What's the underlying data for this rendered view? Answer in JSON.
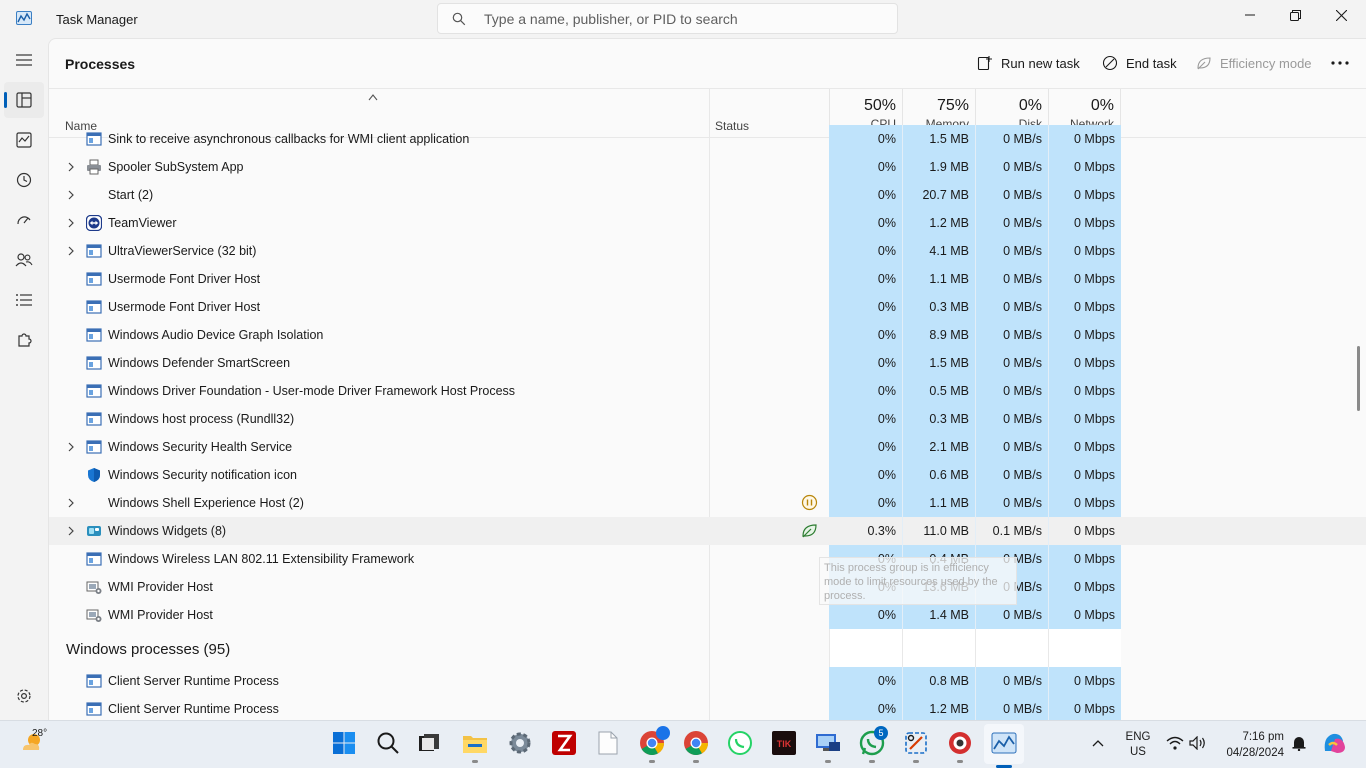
{
  "window": {
    "title": "Task Manager"
  },
  "search": {
    "placeholder": "Type a name, publisher, or PID to search"
  },
  "page": {
    "title": "Processes"
  },
  "toolbar": {
    "run_new_task": "Run new task",
    "end_task": "End task",
    "efficiency_mode": "Efficiency mode"
  },
  "columns": {
    "name": "Name",
    "status": "Status",
    "cpu": {
      "percent": "50%",
      "label": "CPU"
    },
    "memory": {
      "percent": "75%",
      "label": "Memory"
    },
    "disk": {
      "percent": "0%",
      "label": "Disk"
    },
    "network": {
      "percent": "0%",
      "label": "Network"
    }
  },
  "rows": [
    {
      "name": "Sink to receive asynchronous callbacks for WMI client application",
      "expandable": false,
      "icon": "window-icon",
      "cpu": "0%",
      "memory": "1.5 MB",
      "disk": "0 MB/s",
      "network": "0 Mbps"
    },
    {
      "name": "Spooler SubSystem App",
      "expandable": true,
      "icon": "printer-icon",
      "cpu": "0%",
      "memory": "1.9 MB",
      "disk": "0 MB/s",
      "network": "0 Mbps"
    },
    {
      "name": "Start (2)",
      "expandable": true,
      "icon": "",
      "cpu": "0%",
      "memory": "20.7 MB",
      "disk": "0 MB/s",
      "network": "0 Mbps"
    },
    {
      "name": "TeamViewer",
      "expandable": true,
      "icon": "teamviewer-icon",
      "cpu": "0%",
      "memory": "1.2 MB",
      "disk": "0 MB/s",
      "network": "0 Mbps"
    },
    {
      "name": "UltraViewerService (32 bit)",
      "expandable": true,
      "icon": "window-icon",
      "cpu": "0%",
      "memory": "4.1 MB",
      "disk": "0 MB/s",
      "network": "0 Mbps"
    },
    {
      "name": "Usermode Font Driver Host",
      "expandable": false,
      "icon": "window-icon",
      "cpu": "0%",
      "memory": "1.1 MB",
      "disk": "0 MB/s",
      "network": "0 Mbps"
    },
    {
      "name": "Usermode Font Driver Host",
      "expandable": false,
      "icon": "window-icon",
      "cpu": "0%",
      "memory": "0.3 MB",
      "disk": "0 MB/s",
      "network": "0 Mbps"
    },
    {
      "name": "Windows Audio Device Graph Isolation",
      "expandable": false,
      "icon": "window-icon",
      "cpu": "0%",
      "memory": "8.9 MB",
      "disk": "0 MB/s",
      "network": "0 Mbps"
    },
    {
      "name": "Windows Defender SmartScreen",
      "expandable": false,
      "icon": "window-icon",
      "cpu": "0%",
      "memory": "1.5 MB",
      "disk": "0 MB/s",
      "network": "0 Mbps"
    },
    {
      "name": "Windows Driver Foundation - User-mode Driver Framework Host Process",
      "expandable": false,
      "icon": "window-icon",
      "cpu": "0%",
      "memory": "0.5 MB",
      "disk": "0 MB/s",
      "network": "0 Mbps"
    },
    {
      "name": "Windows host process (Rundll32)",
      "expandable": false,
      "icon": "window-icon",
      "cpu": "0%",
      "memory": "0.3 MB",
      "disk": "0 MB/s",
      "network": "0 Mbps"
    },
    {
      "name": "Windows Security Health Service",
      "expandable": true,
      "icon": "window-icon",
      "cpu": "0%",
      "memory": "2.1 MB",
      "disk": "0 MB/s",
      "network": "0 Mbps"
    },
    {
      "name": "Windows Security notification icon",
      "expandable": false,
      "icon": "shield-icon",
      "cpu": "0%",
      "memory": "0.6 MB",
      "disk": "0 MB/s",
      "network": "0 Mbps"
    },
    {
      "name": "Windows Shell Experience Host (2)",
      "expandable": true,
      "icon": "",
      "status_icon": "suspended-icon",
      "cpu": "0%",
      "memory": "1.1 MB",
      "disk": "0 MB/s",
      "network": "0 Mbps"
    },
    {
      "name": "Windows Widgets (8)",
      "expandable": true,
      "icon": "widgets-icon",
      "status_icon": "efficiency-leaf-icon",
      "highlighted": true,
      "cpu": "0.3%",
      "memory": "11.0 MB",
      "disk": "0.1 MB/s",
      "network": "0 Mbps"
    },
    {
      "name": "Windows Wireless LAN 802.11 Extensibility Framework",
      "expandable": false,
      "icon": "window-icon",
      "cpu": "0%",
      "memory": "0.4 MB",
      "disk": "0 MB/s",
      "network": "0 Mbps"
    },
    {
      "name": "WMI Provider Host",
      "expandable": false,
      "icon": "wmi-icon",
      "cpu": "0%",
      "memory": "13.6 MB",
      "disk": "0 MB/s",
      "network": "0 Mbps"
    },
    {
      "name": "WMI Provider Host",
      "expandable": false,
      "icon": "wmi-icon",
      "cpu": "0%",
      "memory": "1.4 MB",
      "disk": "0 MB/s",
      "network": "0 Mbps"
    }
  ],
  "group": {
    "name": "Windows processes (95)"
  },
  "group_rows": [
    {
      "name": "Client Server Runtime Process",
      "icon": "window-icon",
      "cpu": "0%",
      "memory": "0.8 MB",
      "disk": "0 MB/s",
      "network": "0 Mbps"
    },
    {
      "name": "Client Server Runtime Process",
      "icon": "window-icon",
      "cpu": "0%",
      "memory": "1.2 MB",
      "disk": "0 MB/s",
      "network": "0 Mbps"
    }
  ],
  "tooltip": {
    "text": "This process group is in efficiency mode to limit resources used by the process."
  },
  "taskbar": {
    "weather_temp": "28°",
    "whatsapp_badge": "5",
    "lang_line1": "ENG",
    "lang_line2": "US",
    "time": "7:16 pm",
    "date": "04/28/2024"
  },
  "colors": {
    "accent": "#005fb8",
    "cell_heat": "#bfe3fb"
  }
}
